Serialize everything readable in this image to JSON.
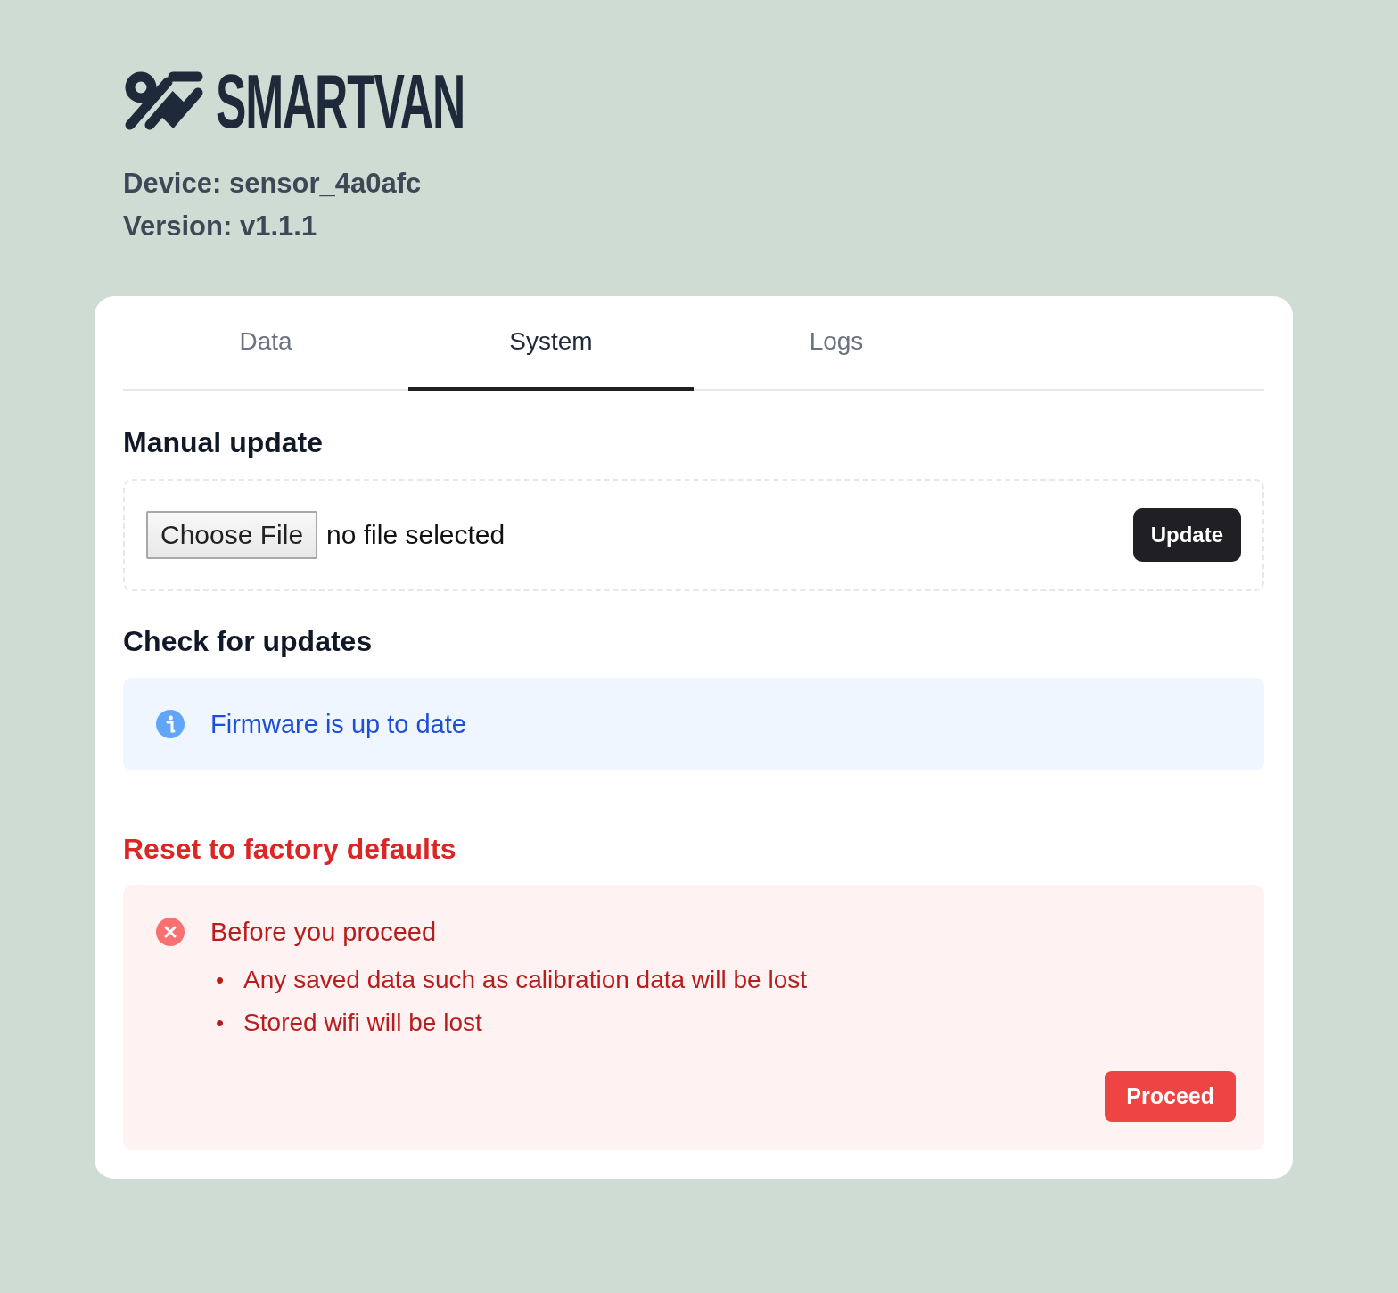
{
  "header": {
    "wordmark": "SMARTVAN",
    "device_line": "Device: sensor_4a0afc",
    "version_line": "Version: v1.1.1"
  },
  "tabs": [
    {
      "label": "Data",
      "selected": false
    },
    {
      "label": "System",
      "selected": true
    },
    {
      "label": "Logs",
      "selected": false
    }
  ],
  "manual_update": {
    "title": "Manual update",
    "file_button": "Choose File",
    "file_status": "no file selected",
    "button": "Update"
  },
  "check_updates": {
    "title": "Check for updates",
    "alert": {
      "kind": "info",
      "text": "Firmware is up to date"
    }
  },
  "reset": {
    "title": "Reset to factory defaults",
    "alert": {
      "kind": "error",
      "title": "Before you proceed",
      "items": [
        {
          "bullet": "•",
          "text": "Any saved data such as calibration data will be lost"
        },
        {
          "bullet": "•",
          "text": "Stored wifi will be lost"
        }
      ],
      "button": "Proceed"
    }
  }
}
